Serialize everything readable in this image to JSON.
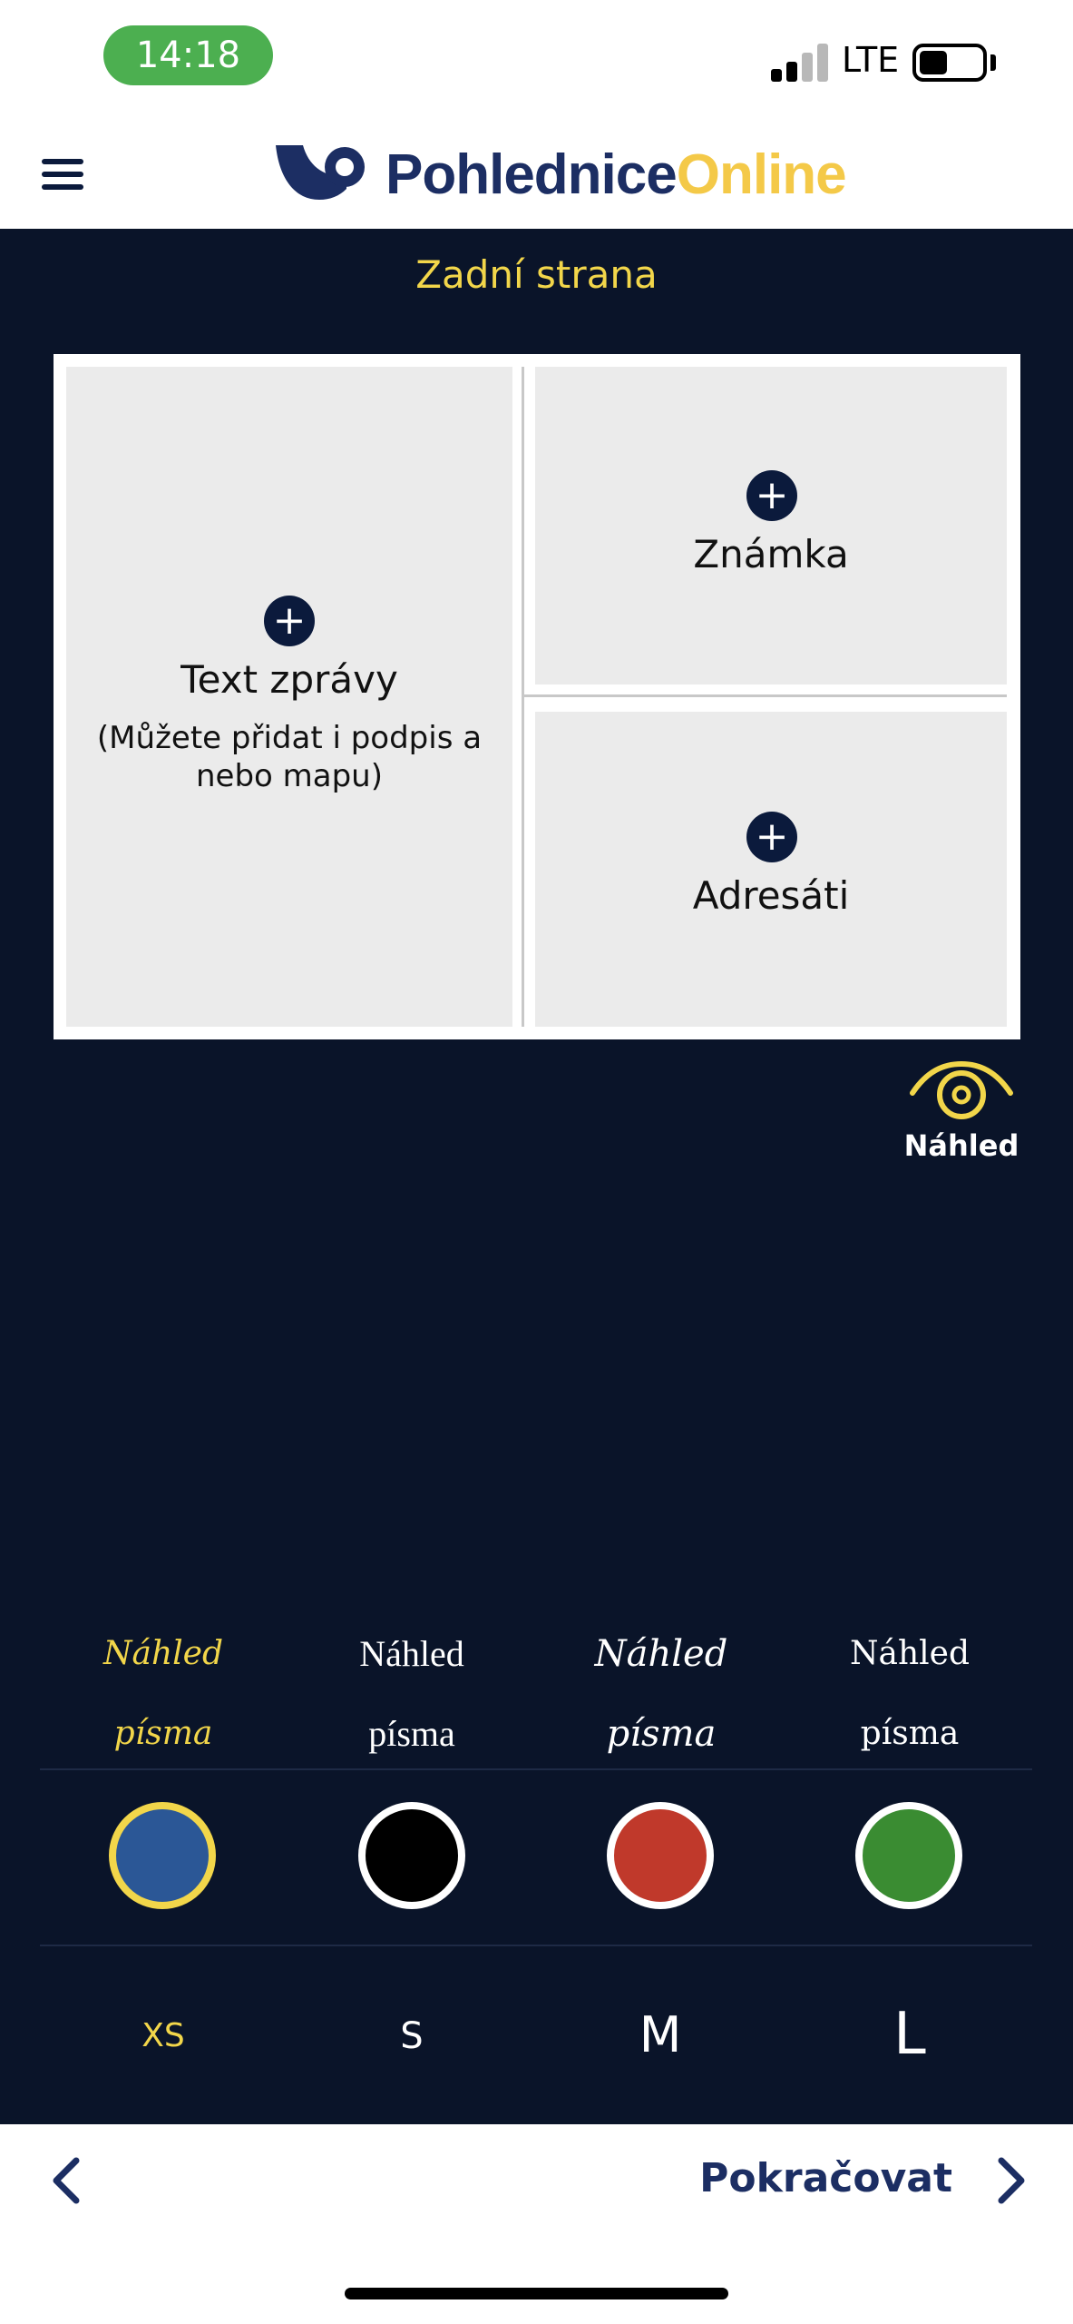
{
  "status_bar": {
    "time": "14:18",
    "network": "LTE"
  },
  "header": {
    "logo_part1": "Pohlednice",
    "logo_part2": "Online"
  },
  "page": {
    "title": "Zadní strana"
  },
  "card": {
    "message": {
      "label": "Text zprávy",
      "sub_line1": "(Můžete přidat i podpis a",
      "sub_line2": "nebo mapu)"
    },
    "stamp": {
      "label": "Známka"
    },
    "recipients": {
      "label": "Adresáti"
    },
    "plus_glyph": "+"
  },
  "preview": {
    "label": "Náhled"
  },
  "fonts": [
    {
      "line1": "Náhled",
      "line2": "písma",
      "selected": true
    },
    {
      "line1": "Náhled",
      "line2": "písma",
      "selected": false
    },
    {
      "line1": "Náhled",
      "line2": "písma",
      "selected": false
    },
    {
      "line1": "Náhled",
      "line2": "písma",
      "selected": false
    }
  ],
  "colors": [
    {
      "hex": "#2b5796",
      "selected": true
    },
    {
      "hex": "#000000",
      "selected": false
    },
    {
      "hex": "#c0392b",
      "selected": false
    },
    {
      "hex": "#3a8c32",
      "selected": false
    }
  ],
  "sizes": [
    {
      "label": "XS",
      "selected": true
    },
    {
      "label": "S",
      "selected": false
    },
    {
      "label": "M",
      "selected": false
    },
    {
      "label": "L",
      "selected": false
    }
  ],
  "footer": {
    "continue_label": "Pokračovat"
  },
  "theme": {
    "accent": "#f2d64a",
    "background": "#0a1429",
    "brand": "#1c2e63"
  }
}
